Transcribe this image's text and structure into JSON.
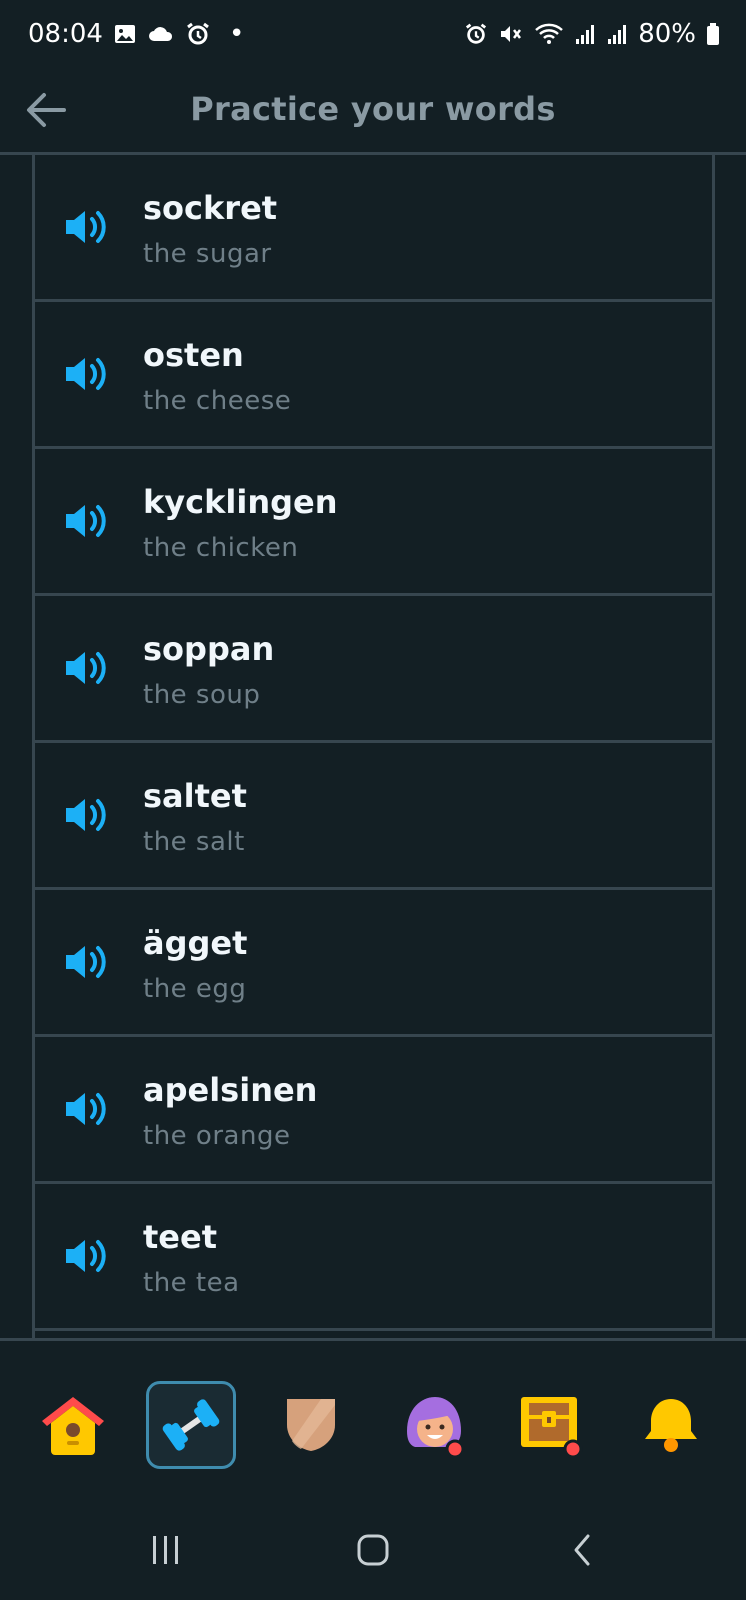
{
  "status_bar": {
    "time": "08:04",
    "dot": "•",
    "battery": "80%",
    "icons_left": [
      "gallery-icon",
      "cloud-icon",
      "alarm-icon"
    ],
    "icons_right": [
      "alarm-icon",
      "mute-icon",
      "wifi-icon",
      "signal-icon",
      "signal-icon",
      "battery-icon"
    ]
  },
  "header": {
    "back_icon": "arrow-left-icon",
    "title": "Practice your words"
  },
  "words": [
    {
      "word": "sockret",
      "translation": "the sugar"
    },
    {
      "word": "osten",
      "translation": "the cheese"
    },
    {
      "word": "kycklingen",
      "translation": "the chicken"
    },
    {
      "word": "soppan",
      "translation": "the soup"
    },
    {
      "word": "saltet",
      "translation": "the salt"
    },
    {
      "word": "ägget",
      "translation": "the egg"
    },
    {
      "word": "apelsinen",
      "translation": "the orange"
    },
    {
      "word": "teet",
      "translation": "the tea"
    }
  ],
  "bottom_nav": {
    "items": [
      {
        "name": "home",
        "icon": "house-icon",
        "active": false
      },
      {
        "name": "practice",
        "icon": "dumbbell-icon",
        "active": true
      },
      {
        "name": "leagues",
        "icon": "shield-icon",
        "active": false
      },
      {
        "name": "profile",
        "icon": "avatar-icon",
        "active": false
      },
      {
        "name": "shop",
        "icon": "chest-icon",
        "active": false
      },
      {
        "name": "notifications",
        "icon": "bell-icon",
        "active": false
      }
    ]
  },
  "colors": {
    "background": "#131f24",
    "border": "#37464f",
    "accent_blue": "#1cb0f6",
    "active_border": "#3f8cae",
    "title_gray": "#8a9aa3",
    "translation_gray": "#6f7f88"
  }
}
